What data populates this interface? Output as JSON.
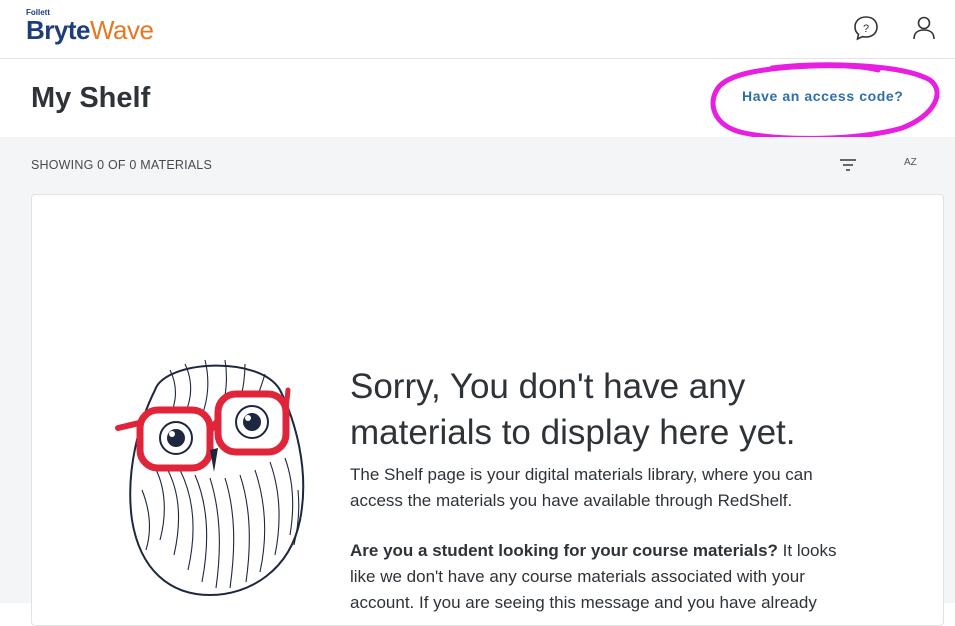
{
  "header": {
    "logo_top": "Follett",
    "logo_part1": "Bryte",
    "logo_part2": "Wave",
    "icons": [
      "chat-help-icon",
      "user-icon"
    ]
  },
  "page": {
    "title": "My Shelf",
    "access_link": "Have an access code?"
  },
  "toolbar": {
    "showing_text": "SHOWING 0 OF 0 MATERIALS",
    "sort_label": "AZ",
    "filter_icon": "filter-icon"
  },
  "empty_state": {
    "title": "Sorry, You don't have any materials to display here yet.",
    "description": "The Shelf page is your digital materials library, where you can access the materials you have available through RedShelf.",
    "student_question": "Are you a student looking for your course materials?",
    "student_text": " It looks like we don't have any course materials associated with your account. If you are seeing this message and you have already"
  },
  "colors": {
    "brand_blue": "#1f3d7a",
    "brand_orange": "#e87722",
    "link": "#2d6fa8",
    "highlight": "#e81ee0",
    "glasses": "#e0253a"
  }
}
